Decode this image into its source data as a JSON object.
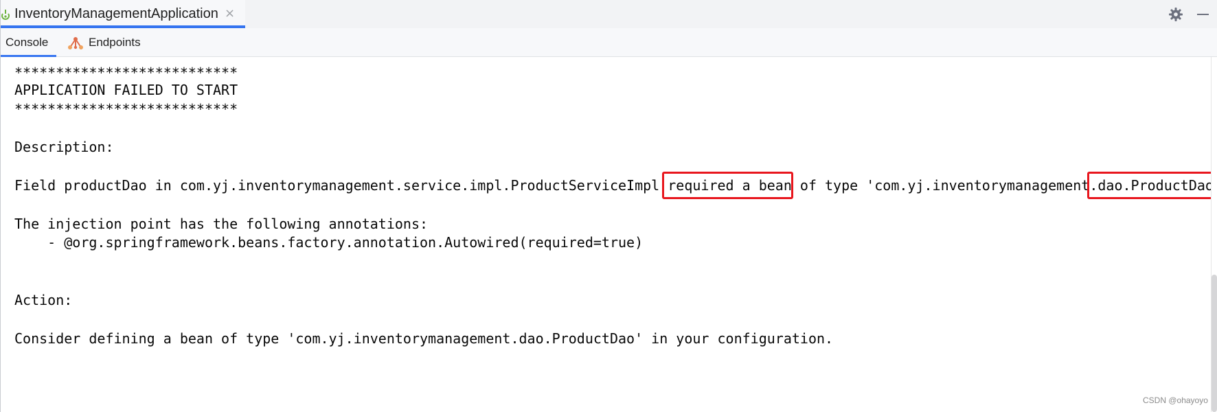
{
  "run_tab": {
    "title": "InventoryManagementApplication",
    "close_glyph": "×",
    "icon": "spring-boot-run-icon"
  },
  "toolbar": {
    "settings_icon": "gear-icon",
    "minimize_icon": "minimize-icon"
  },
  "tabs": [
    {
      "label": "Console",
      "active": true
    },
    {
      "label": "Endpoints",
      "active": false,
      "icon": "endpoints-icon"
    }
  ],
  "console": {
    "lines": [
      "***************************",
      "APPLICATION FAILED TO START",
      "***************************",
      "Description:",
      "Field productDao in com.yj.inventorymanagement.service.impl.ProductServiceImpl required a bean of type 'com.yj.inventorymanagement.dao.ProductDao",
      "The injection point has the following annotations:",
      "    - @org.springframework.beans.factory.annotation.Autowired(required=true)",
      "Action:",
      "Consider defining a bean of type 'com.yj.inventorymanagement.dao.ProductDao' in your configuration."
    ],
    "highlights": [
      "required a bean",
      "dao.ProductDao"
    ]
  },
  "watermark": "CSDN @ohayoyo",
  "colors": {
    "accent": "#3574f0",
    "highlight_border": "#e8161d",
    "text": "#080808"
  }
}
